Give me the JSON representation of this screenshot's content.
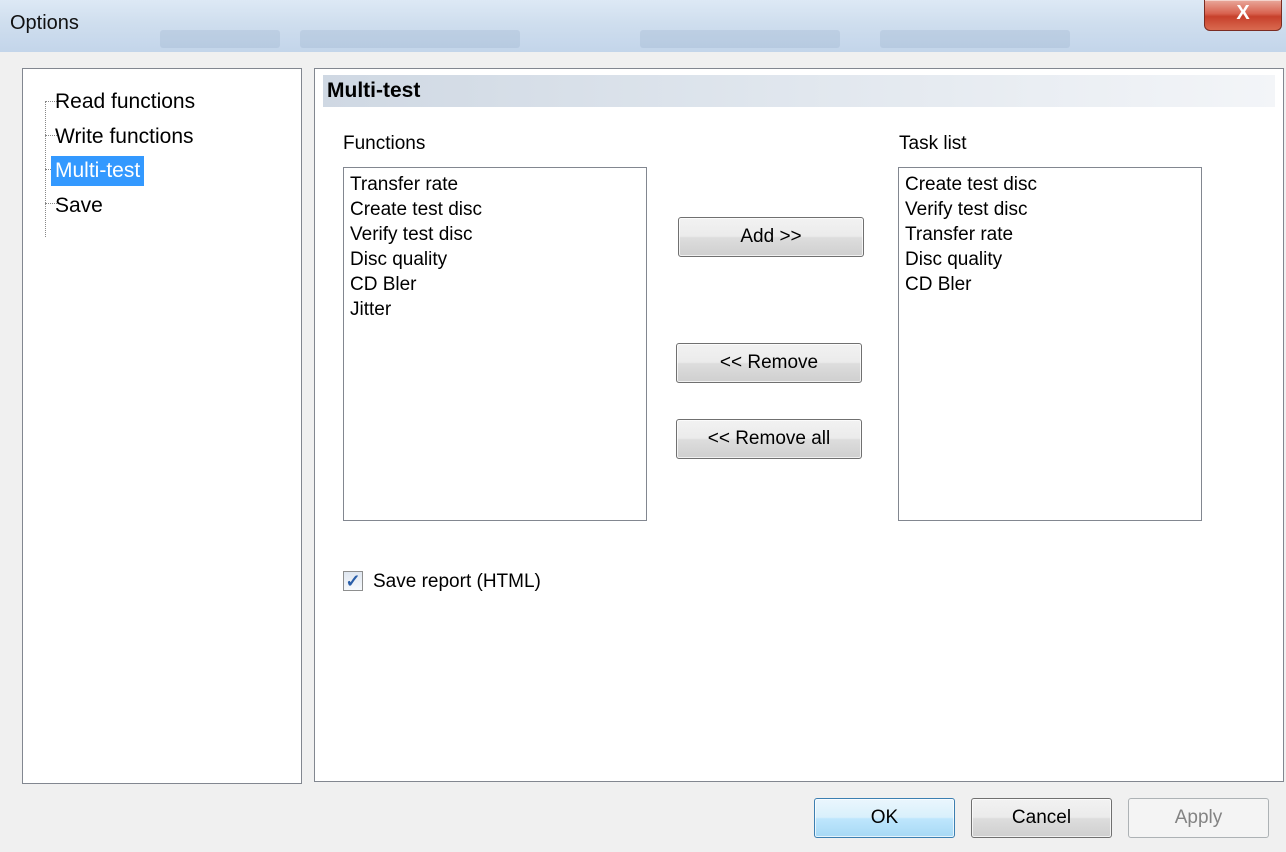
{
  "window": {
    "title": "Options",
    "close_glyph": "X"
  },
  "tree": {
    "items": [
      {
        "label": "Read functions",
        "selected": false
      },
      {
        "label": "Write functions",
        "selected": false
      },
      {
        "label": "Multi-test",
        "selected": true
      },
      {
        "label": "Save",
        "selected": false
      }
    ]
  },
  "panel": {
    "header": "Multi-test",
    "functions": {
      "label": "Functions",
      "items": [
        "Transfer rate",
        "Create test disc",
        "Verify test disc",
        "Disc quality",
        "CD Bler",
        "Jitter"
      ]
    },
    "task_list": {
      "label": "Task list",
      "items": [
        "Create test disc",
        "Verify test disc",
        "Transfer rate",
        "Disc quality",
        "CD Bler"
      ]
    },
    "buttons": {
      "add": "Add >>",
      "remove": "<< Remove",
      "remove_all": "<< Remove all"
    },
    "save_report": {
      "label": "Save report (HTML)",
      "checked": true,
      "check_glyph": "✓"
    }
  },
  "footer": {
    "ok": "OK",
    "cancel": "Cancel",
    "apply": "Apply",
    "apply_enabled": false
  },
  "colors": {
    "selection": "#3399ff",
    "close_button": "#c7402b"
  }
}
